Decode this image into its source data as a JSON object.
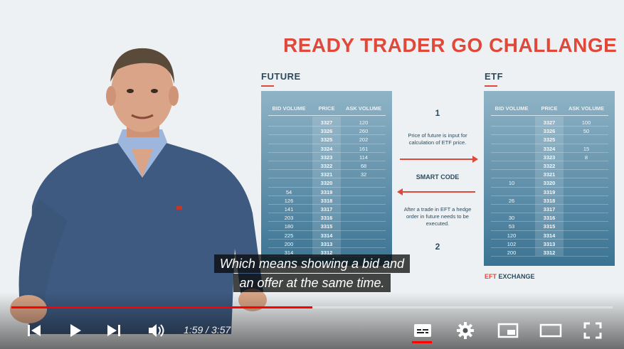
{
  "slide": {
    "title": "READY TRADER GO CHALLANGE",
    "future_label": "FUTURE",
    "etf_label": "ETF",
    "columns": {
      "bid": "BID VOLUME",
      "price": "PRICE",
      "ask": "ASK VOLUME"
    },
    "future_book": [
      {
        "bid": "",
        "price": "3327",
        "ask": "120"
      },
      {
        "bid": "",
        "price": "3326",
        "ask": "260"
      },
      {
        "bid": "",
        "price": "3325",
        "ask": "202"
      },
      {
        "bid": "",
        "price": "3324",
        "ask": "161"
      },
      {
        "bid": "",
        "price": "3323",
        "ask": "114"
      },
      {
        "bid": "",
        "price": "3322",
        "ask": "68"
      },
      {
        "bid": "",
        "price": "3321",
        "ask": "32"
      },
      {
        "bid": "",
        "price": "3320",
        "ask": ""
      },
      {
        "bid": "54",
        "price": "3319",
        "ask": ""
      },
      {
        "bid": "126",
        "price": "3318",
        "ask": ""
      },
      {
        "bid": "141",
        "price": "3317",
        "ask": ""
      },
      {
        "bid": "203",
        "price": "3316",
        "ask": ""
      },
      {
        "bid": "180",
        "price": "3315",
        "ask": ""
      },
      {
        "bid": "225",
        "price": "3314",
        "ask": ""
      },
      {
        "bid": "200",
        "price": "3313",
        "ask": ""
      },
      {
        "bid": "314",
        "price": "3312",
        "ask": ""
      }
    ],
    "etf_book": [
      {
        "bid": "",
        "price": "3327",
        "ask": "100"
      },
      {
        "bid": "",
        "price": "3326",
        "ask": "50"
      },
      {
        "bid": "",
        "price": "3325",
        "ask": ""
      },
      {
        "bid": "",
        "price": "3324",
        "ask": "15"
      },
      {
        "bid": "",
        "price": "3323",
        "ask": "8"
      },
      {
        "bid": "",
        "price": "3322",
        "ask": ""
      },
      {
        "bid": "",
        "price": "3321",
        "ask": ""
      },
      {
        "bid": "10",
        "price": "3320",
        "ask": ""
      },
      {
        "bid": "",
        "price": "3319",
        "ask": ""
      },
      {
        "bid": "26",
        "price": "3318",
        "ask": ""
      },
      {
        "bid": "",
        "price": "3317",
        "ask": ""
      },
      {
        "bid": "30",
        "price": "3316",
        "ask": ""
      },
      {
        "bid": "53",
        "price": "3315",
        "ask": ""
      },
      {
        "bid": "120",
        "price": "3314",
        "ask": ""
      },
      {
        "bid": "102",
        "price": "3313",
        "ask": ""
      },
      {
        "bid": "200",
        "price": "3312",
        "ask": ""
      }
    ],
    "middle": {
      "step1": "1",
      "step1_text": "Price of future is input for calculation of ETF price.",
      "smart_code": "SMART CODE",
      "step2_text": "After a trade in EFT a hedge order in future needs to be executed.",
      "step2": "2"
    },
    "etf_exchange_prefix": "EFT",
    "etf_exchange_suffix": " EXCHANGE",
    "accent_color": "#e0483a"
  },
  "captions": {
    "line1": "Which means showing a bid and",
    "line2": "an offer at the same time."
  },
  "player": {
    "progress": 0.5,
    "current_time": "1:59",
    "duration": "3:57",
    "time_separator": " / "
  }
}
